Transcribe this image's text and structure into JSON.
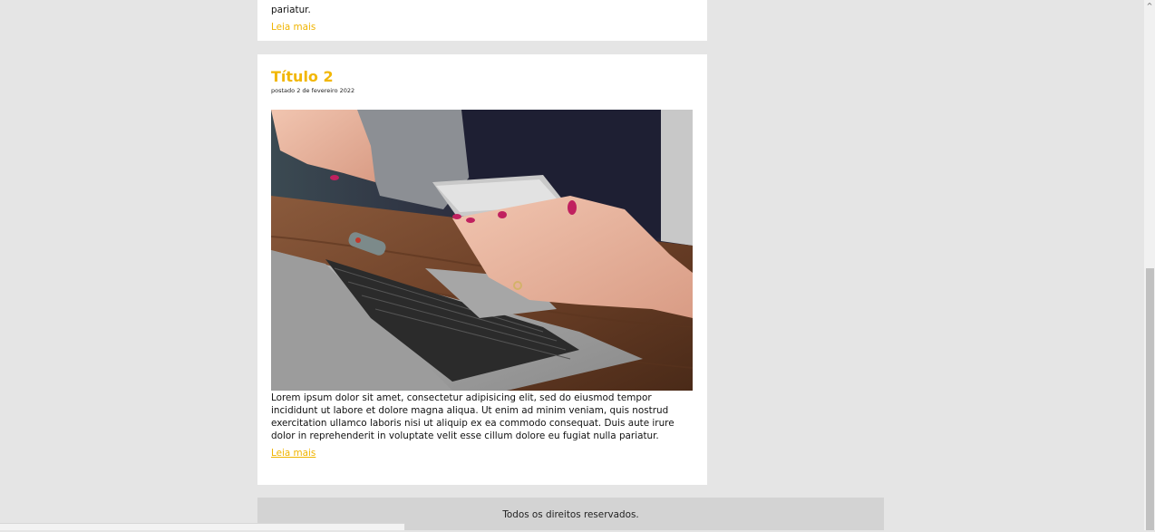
{
  "previous_post": {
    "text_tail": "pariatur.",
    "read_more": "Leia mais"
  },
  "post": {
    "title": "Título 2",
    "date": "postado 2 de fevereiro 2022",
    "body": "Lorem ipsum dolor sit amet, consectetur adipisicing elit, sed do eiusmod tempor incididunt ut labore et dolore magna aliqua. Ut enim ad minim veniam, quis nostrud exercitation ullamco laboris nisi ut aliquip ex ea commodo consequat. Duis aute irure dolor in reprehenderit in voluptate velit esse cillum dolore eu fugiat nulla pariatur.",
    "read_more": "Leia mais",
    "image_icon": "photo-laptop-phone"
  },
  "footer": {
    "text": "Todos os direitos reservados."
  },
  "scrollbar": {
    "up_icon": "chevron-up-icon",
    "up_glyph": "^"
  },
  "colors": {
    "accent": "#f2b705",
    "background": "#e5e5e5",
    "card": "#ffffff",
    "footer": "#d3d3d3"
  }
}
